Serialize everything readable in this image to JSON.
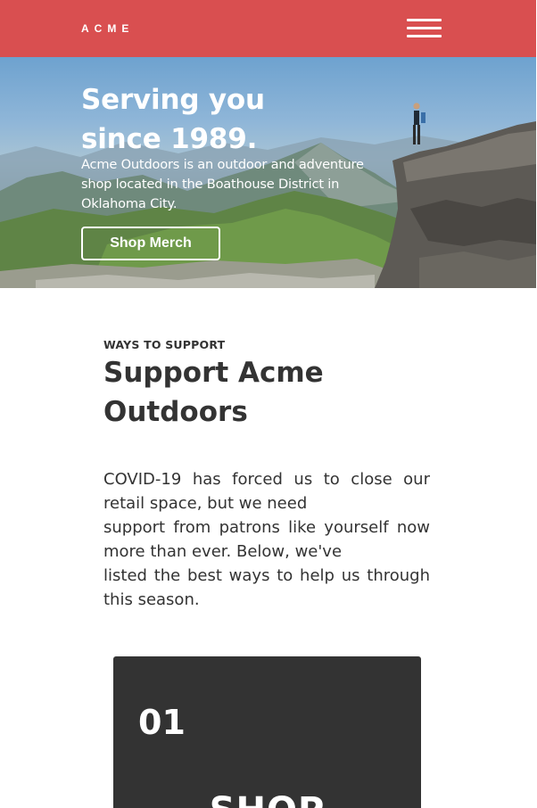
{
  "header": {
    "brand": "ACME",
    "menu_icon": "hamburger-menu-icon"
  },
  "hero": {
    "title": "Serving you since 1989.",
    "description": "Acme Outdoors is an outdoor and adventure shop located in the Boathouse District in Oklahoma City.",
    "cta_label": "Shop Merch",
    "image": "mountain-hiker-photo"
  },
  "support": {
    "eyebrow": "WAYS TO SUPPORT",
    "title": "Support Acme Outdoors",
    "body_lines": [
      "COVID-19 has forced us to close our",
      "retail space, but we need",
      "support from patrons like yourself now",
      "more than ever. Below, we've",
      "listed the best ways to help us through",
      "this season."
    ]
  },
  "card": {
    "number": "01",
    "heading": "SHOP"
  },
  "colors": {
    "header_bg": "#d94f50",
    "text": "#333333",
    "card_bg": "#333333",
    "white": "#ffffff"
  }
}
